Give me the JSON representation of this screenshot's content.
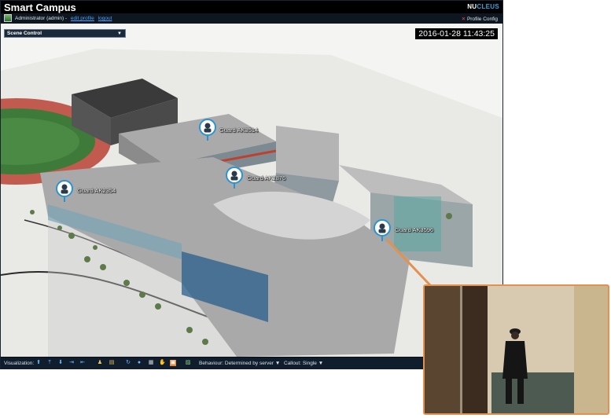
{
  "app": {
    "title": "Smart Campus"
  },
  "logo": {
    "part1": "NU",
    "part2": "CLEUS"
  },
  "user": {
    "label": "Administrator (admin) -",
    "edit_profile": "edit profile",
    "logout": "logout",
    "profile_config": "Profile Config"
  },
  "scene_control": {
    "label": "Scene Control"
  },
  "timestamp": "2016-01-28 11:43:25",
  "guards": [
    {
      "name": "Guard AK3514"
    },
    {
      "name": "Guard AK2876"
    },
    {
      "name": "Guard AK2354"
    },
    {
      "name": "Guard AK3596"
    }
  ],
  "toolbar": {
    "visualization_label": "Visualization:",
    "behaviour_label": "Behaviour: Determined by server",
    "callout_label": "Callout: Single"
  },
  "colors": {
    "accent": "#e2914f",
    "link": "#47a3ff",
    "brand": "#2aa9e0",
    "toolbar_bg": "#0f1d2c"
  },
  "icons": [
    "user-avatar-icon",
    "profile-config-icon",
    "chevron-down-icon",
    "guard-marker-icon",
    "move-up-icon",
    "move-down-icon",
    "camera-icon",
    "rotate-icon",
    "grid-icon",
    "hand-icon",
    "layer-icon"
  ]
}
